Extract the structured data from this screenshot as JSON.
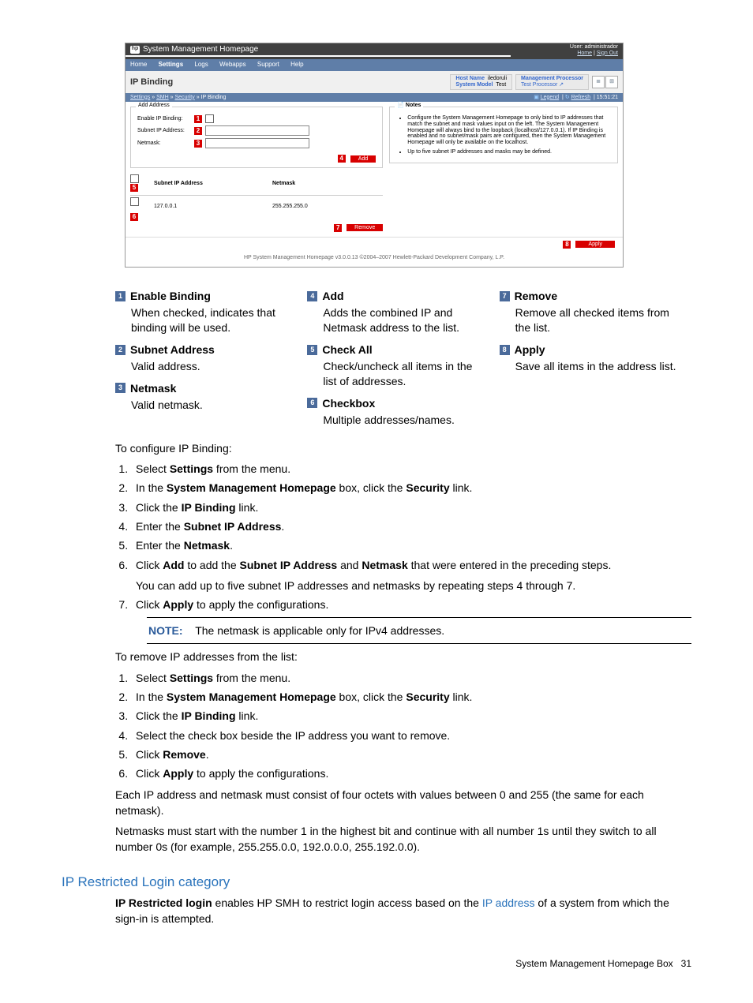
{
  "shot": {
    "app_title": "System Management Homepage",
    "user_label": "User: administrador",
    "user_home": "Home",
    "user_signout": "Sign Out",
    "menu": [
      "Home",
      "Settings",
      "Logs",
      "Webapps",
      "Support",
      "Help"
    ],
    "page_title": "IP Binding",
    "host_name_lbl": "Host Name",
    "host_name_val": "iledoruli",
    "system_model_lbl": "System Model",
    "system_model_val": "Test",
    "mgmt_proc_lbl": "Management Processor",
    "mgmt_proc_val": "Test Processor ↗",
    "crumb": {
      "a1": "Settings",
      "a2": "SMH",
      "a3": "Security",
      "cur": "IP Binding"
    },
    "crumb_legend": "Legend",
    "crumb_refresh": "Refresh",
    "crumb_time": "15:51:21",
    "fieldset_legend": "Add Address",
    "enable_lbl": "Enable IP Binding:",
    "subnet_lbl": "Subnet IP Address:",
    "netmask_lbl": "Netmask:",
    "add_btn": "Add",
    "col_subnet": "Subnet IP Address",
    "col_netmask": "Netmask",
    "row_ip": "127.0.0.1",
    "row_mask": "255.255.255.0",
    "remove_btn": "Remove",
    "notes_title": "Notes",
    "note1": "Configure the System Management Homepage to only bind to IP addresses that match the subnet and mask values input on the left. The System Management Homepage will always bind to the loopback (localhost/127.0.0.1). If IP Binding is enabled and no subnet/mask pairs are configured, then the System Management Homepage will only be available on the localhost.",
    "note2": "Up to five subnet IP addresses and masks may be defined.",
    "apply_btn": "Apply",
    "copyright": "HP System Management Homepage v3.0.0.13    ©2004–2007 Hewlett-Packard Development Company, L.P."
  },
  "m": {
    "1": "1",
    "2": "2",
    "3": "3",
    "4": "4",
    "5": "5",
    "6": "6",
    "7": "7",
    "8": "8"
  },
  "items": {
    "i1": {
      "t": "Enable Binding",
      "p": "When checked, indicates that binding will be used."
    },
    "i2": {
      "t": "Subnet Address",
      "p": "Valid address."
    },
    "i3": {
      "t": "Netmask",
      "p": "Valid netmask."
    },
    "i4": {
      "t": "Add",
      "p": "Adds the combined IP and Netmask address to the list."
    },
    "i5": {
      "t": "Check All",
      "p": "Check/uncheck all items in the list of addresses."
    },
    "i6": {
      "t": "Checkbox",
      "p": "Multiple addresses/names."
    },
    "i7": {
      "t": "Remove",
      "p": "Remove all checked items from the list."
    },
    "i8": {
      "t": "Apply",
      "p": "Save all items in the address list."
    }
  },
  "text": {
    "intro": "To configure IP Binding:",
    "s1a": "Select ",
    "s1b": "Settings",
    "s1c": " from the menu.",
    "s2a": "In the ",
    "s2b": "System Management Homepage",
    "s2c": " box, click the ",
    "s2d": "Security",
    "s2e": " link.",
    "s3a": "Click the ",
    "s3b": "IP Binding",
    "s3c": " link.",
    "s4a": "Enter the ",
    "s4b": "Subnet IP Address",
    "s4c": ".",
    "s5a": "Enter the ",
    "s5b": "Netmask",
    "s5c": ".",
    "s6a": "Click ",
    "s6b": "Add",
    "s6c": " to add the ",
    "s6d": "Subnet IP Address",
    "s6e": " and ",
    "s6f": "Netmask",
    "s6g": " that were entered in the preceding steps.",
    "s6p": "You can add up to five subnet IP addresses and netmasks by repeating steps 4 through 7.",
    "s7a": "Click ",
    "s7b": "Apply",
    "s7c": " to apply the configurations.",
    "note_lbl": "NOTE:",
    "note_txt": "The netmask is applicable only for IPv4 addresses.",
    "rem_intro": "To remove IP addresses from the list:",
    "r4": "Select the check box beside the IP address you want to remove.",
    "r5a": "Click ",
    "r5b": "Remove",
    "r5c": ".",
    "r6a": "Click ",
    "r6b": "Apply",
    "r6c": " to apply the configurations.",
    "p1": "Each IP address and netmask must consist of four octets with values between 0 and 255 (the same for each netmask).",
    "p2": "Netmasks must start with the number 1 in the highest bit and continue with all number 1s until they switch to all number 0s (for example, 255.255.0.0, 192.0.0.0, 255.192.0.0).",
    "h3": "IP Restricted Login category",
    "p3a": "IP Restricted login",
    "p3b": " enables HP SMH to restrict login access based on the ",
    "p3c": "IP address",
    "p3d": " of a system from which the sign-in is attempted.",
    "foot_txt": "System Management Homepage Box",
    "foot_pg": "31"
  }
}
